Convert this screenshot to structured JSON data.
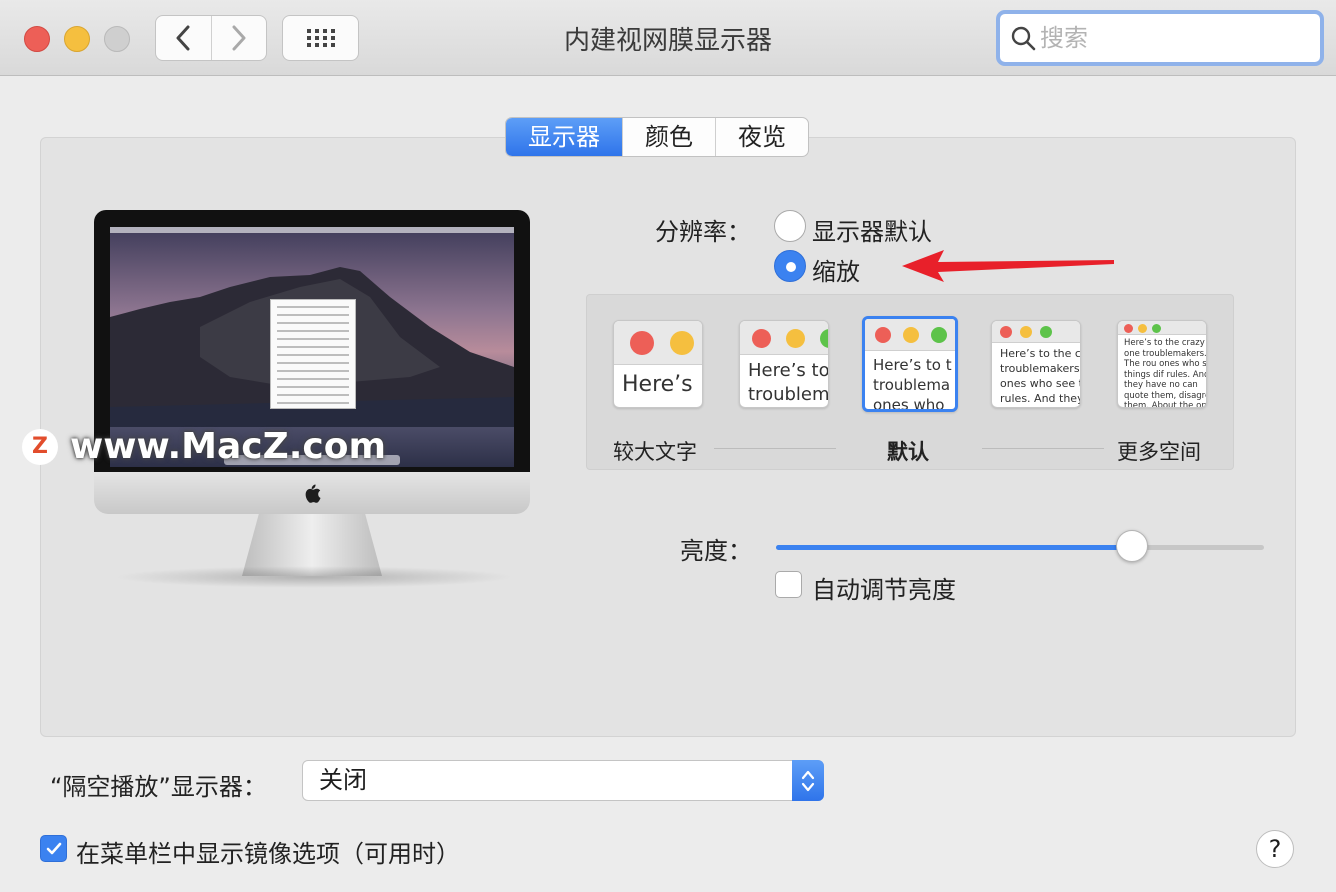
{
  "window": {
    "title": "内建视网膜显示器",
    "search_placeholder": "搜索"
  },
  "tabs": [
    {
      "label": "显示器",
      "active": true
    },
    {
      "label": "颜色",
      "active": false
    },
    {
      "label": "夜览",
      "active": false
    }
  ],
  "watermark": {
    "logo": "Z",
    "text": "www.MacZ.com"
  },
  "resolution": {
    "label": "分辨率：",
    "options": [
      {
        "label": "显示器默认",
        "selected": false
      },
      {
        "label": "缩放",
        "selected": true
      }
    ]
  },
  "scale": {
    "selected_index": 2,
    "thumb_texts": [
      "Here’s",
      "Here’s to troublem",
      "Here’s to t troublema ones who",
      "Here’s to the cr troublemakers. ones who see t rules. And they",
      "Here’s to the crazy one troublemakers. The rou ones who see things dif rules. And they have no can quote them, disagre them. About the only th Because they change th"
    ],
    "labels": {
      "left": "较大文字",
      "middle": "默认",
      "right": "更多空间"
    }
  },
  "brightness": {
    "label": "亮度：",
    "level": 0.73,
    "auto_label": "自动调节亮度",
    "auto_checked": false
  },
  "airplay": {
    "label": "“隔空播放”显示器：",
    "value": "关闭"
  },
  "mirror": {
    "label": "在菜单栏中显示镜像选项（可用时）",
    "checked": true
  },
  "help": {
    "label": "?"
  },
  "colors": {
    "accent": "#3b82f0",
    "annotation_arrow": "#e8202a"
  }
}
